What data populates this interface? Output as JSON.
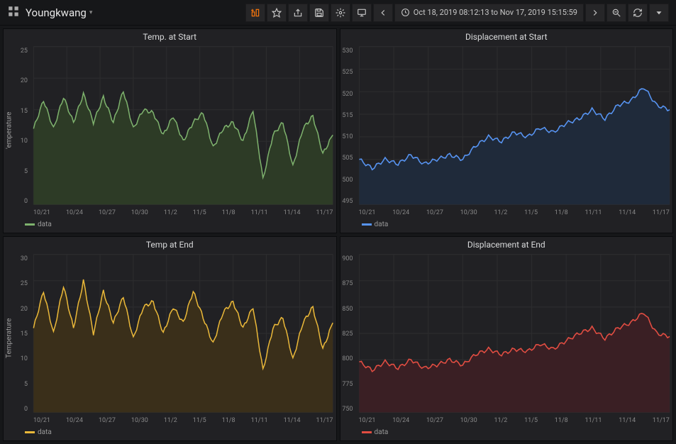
{
  "header": {
    "title": "Youngkwang",
    "timerange": "Oct 18, 2019 08:12:13 to Nov 17, 2019 15:15:59",
    "icons": {
      "addpanel": "add-panel",
      "star": "star",
      "share": "share",
      "save": "save",
      "settings": "gear",
      "cycle": "monitor",
      "prev": "chevron-left",
      "next": "chevron-right",
      "zoomout": "search-minus",
      "refresh": "refresh",
      "refreshmenu": "caret-down"
    }
  },
  "xticks": [
    "10/21",
    "10/24",
    "10/27",
    "10/30",
    "11/2",
    "11/5",
    "11/8",
    "11/11",
    "11/14",
    "11/17"
  ],
  "chart_data": [
    {
      "id": "temp_start",
      "title": "Temp. at Start",
      "ylabel": "'emperature",
      "type": "area",
      "color": "#7EB26D",
      "fill": "#2d3b26",
      "legend": "data",
      "ylim": [
        0,
        25
      ],
      "yticks": [
        25,
        20,
        15,
        10,
        5,
        0
      ],
      "categories": [
        "10/21",
        "10/24",
        "10/27",
        "10/30",
        "11/2",
        "11/5",
        "11/8",
        "11/11",
        "11/14",
        "11/17"
      ],
      "x": [
        0,
        0.4,
        0.8,
        1.2,
        1.6,
        2,
        2.4,
        2.8,
        3.2,
        3.6,
        4,
        4.4,
        4.8,
        5.2,
        5.6,
        6,
        6.4,
        6.8,
        7.2,
        7.6,
        8,
        8.4,
        8.8,
        9.2,
        9.6,
        10,
        10.4,
        10.8,
        11.2,
        11.6,
        12
      ],
      "values": [
        12,
        16.5,
        12,
        17,
        13,
        17.5,
        13,
        17,
        13,
        18,
        12,
        15,
        14.5,
        11,
        14,
        10,
        13,
        14.5,
        9,
        12,
        13,
        10,
        15,
        4,
        11,
        13,
        6,
        12,
        14,
        8,
        11
      ]
    },
    {
      "id": "disp_start",
      "title": "Displacement at Start",
      "ylabel": "",
      "type": "area",
      "color": "#6ED0E0",
      "altcolor": "#5794F2",
      "fill": "#1f2a3a",
      "legend": "data",
      "ylim": [
        495,
        530
      ],
      "yticks": [
        530,
        525,
        520,
        515,
        510,
        505,
        500,
        495
      ],
      "categories": [
        "10/21",
        "10/24",
        "10/27",
        "10/30",
        "11/2",
        "11/5",
        "11/8",
        "11/11",
        "11/14",
        "11/17"
      ],
      "x": [
        0,
        0.5,
        1,
        1.5,
        2,
        2.5,
        3,
        3.5,
        4,
        4.5,
        5,
        5.5,
        6,
        6.5,
        7,
        7.5,
        8,
        8.5,
        9,
        9.5,
        10,
        10.5,
        11,
        11.5,
        12
      ],
      "values": [
        505,
        503,
        505,
        504,
        506,
        504,
        505,
        506,
        505,
        508,
        510,
        509,
        511,
        510,
        512,
        511,
        513,
        514,
        516,
        514,
        517,
        518,
        521,
        517,
        516
      ]
    },
    {
      "id": "temp_end",
      "title": "Temp at End",
      "ylabel": "Temperature",
      "type": "area",
      "color": "#EAB839",
      "fill": "#3a2f1a",
      "legend": "data",
      "ylim": [
        0,
        30
      ],
      "yticks": [
        30,
        25,
        20,
        15,
        10,
        5,
        0
      ],
      "categories": [
        "10/21",
        "10/24",
        "10/27",
        "10/30",
        "11/2",
        "11/5",
        "11/8",
        "11/11",
        "11/14",
        "11/17"
      ],
      "x": [
        0,
        0.4,
        0.8,
        1.2,
        1.6,
        2,
        2.4,
        2.8,
        3.2,
        3.6,
        4,
        4.4,
        4.8,
        5.2,
        5.6,
        6,
        6.4,
        6.8,
        7.2,
        7.6,
        8,
        8.4,
        8.8,
        9.2,
        9.6,
        10,
        10.4,
        10.8,
        11.2,
        11.6,
        12
      ],
      "values": [
        16,
        23,
        15,
        24,
        16,
        25,
        15,
        23,
        17,
        22,
        14,
        20,
        21,
        15,
        20,
        17,
        23,
        18,
        13,
        19,
        21,
        16,
        20,
        8,
        16,
        18,
        10,
        17,
        20,
        12,
        17
      ]
    },
    {
      "id": "disp_end",
      "title": "Displacement at End",
      "ylabel": "",
      "type": "area",
      "color": "#E24D42",
      "fill": "#3a1f24",
      "legend": "data",
      "ylim": [
        750,
        900
      ],
      "yticks": [
        900,
        875,
        850,
        825,
        800,
        775,
        750
      ],
      "categories": [
        "10/21",
        "10/24",
        "10/27",
        "10/30",
        "11/2",
        "11/5",
        "11/8",
        "11/11",
        "11/14",
        "11/17"
      ],
      "x": [
        0,
        0.5,
        1,
        1.5,
        2,
        2.5,
        3,
        3.5,
        4,
        4.5,
        5,
        5.5,
        6,
        6.5,
        7,
        7.5,
        8,
        8.5,
        9,
        9.5,
        10,
        10.5,
        11,
        11.5,
        12
      ],
      "values": [
        798,
        790,
        798,
        792,
        800,
        792,
        795,
        800,
        795,
        805,
        810,
        805,
        810,
        808,
        815,
        810,
        818,
        825,
        830,
        820,
        830,
        835,
        845,
        825,
        822
      ]
    }
  ]
}
